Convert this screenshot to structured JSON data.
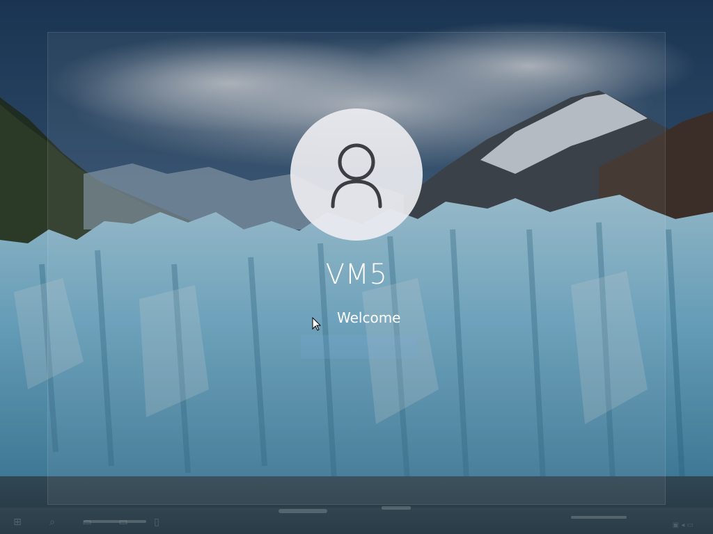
{
  "screen": {
    "type": "lock-screen",
    "accent_color": "#ffffff"
  },
  "user": {
    "name": "VM5",
    "status_text": "Welcome",
    "avatar_icon": "user-icon"
  },
  "taskbar": {
    "icons": [
      "windows-start-icon",
      "search-icon",
      "task-view-icon",
      "edge-icon",
      "file-explorer-icon"
    ],
    "tray_icons": [
      "network-icon",
      "volume-icon",
      "notification-icon"
    ]
  },
  "background": {
    "scene": "glacier-with-mountains",
    "sky_color": "#2c4a68",
    "ice_color": "#a9d6e8",
    "water_color": "#3f5b68"
  }
}
